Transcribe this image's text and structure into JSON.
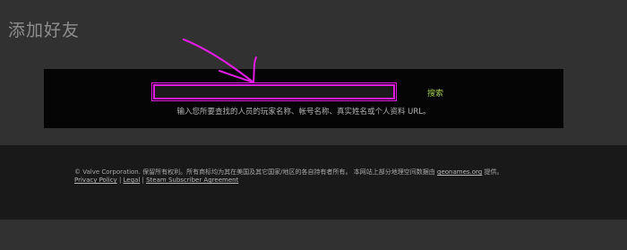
{
  "header": {
    "title": "添加好友"
  },
  "search": {
    "value": "",
    "button_label": "搜索",
    "hint": "输入您所要查找的人员的玩家名称、帐号名称、真实姓名或个人资料 URL。"
  },
  "annotation": {
    "color": "#e21ce4",
    "icon": "hand-drawn-arrow-icon"
  },
  "footer": {
    "copyright_prefix": "© Valve Corporation. 保留所有权利。所有商标均为其在美国及其它国家/地区的各自持有者所有。 本网站上部分地理空间数据由 ",
    "geonames_link": "geonames.org",
    "copyright_suffix": " 提供。",
    "links": [
      {
        "label": "Privacy Policy"
      },
      {
        "label": "Legal"
      },
      {
        "label": "Steam Subscriber Agreement"
      }
    ],
    "separator": " | "
  },
  "colors": {
    "background": "#313131",
    "panel": "#050505",
    "footer": "#191919",
    "accent_green": "#a2cc4f"
  }
}
